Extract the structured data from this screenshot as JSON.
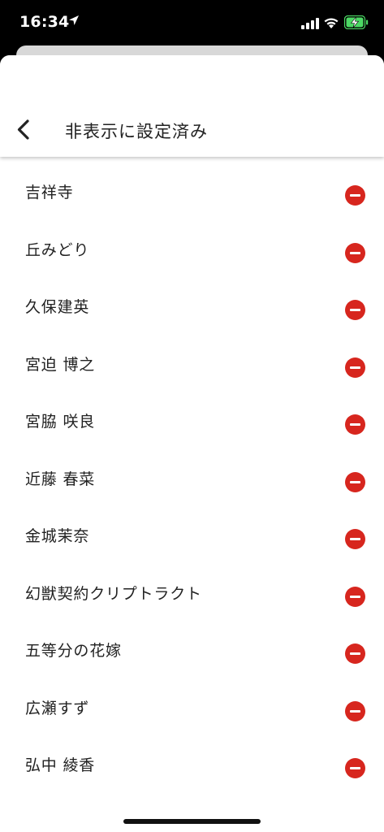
{
  "status_bar": {
    "time": "16:34",
    "location_icon": "location-arrow-icon",
    "signal_icon": "cellular-signal-icon",
    "wifi_icon": "wifi-icon",
    "battery_icon": "battery-charging-icon",
    "battery_color": "#4cd964"
  },
  "header": {
    "back_icon": "chevron-left-icon",
    "title": "非表示に設定済み"
  },
  "colors": {
    "remove_button": "#d7261e",
    "text": "#222222"
  },
  "hidden_list": {
    "remove_icon": "minus-circle-icon",
    "items": [
      {
        "label": "吉祥寺"
      },
      {
        "label": "丘みどり"
      },
      {
        "label": "久保建英"
      },
      {
        "label": "宮迫 博之"
      },
      {
        "label": "宮脇 咲良"
      },
      {
        "label": "近藤 春菜"
      },
      {
        "label": "金城茉奈"
      },
      {
        "label": "幻獣契約クリプトラクト"
      },
      {
        "label": "五等分の花嫁"
      },
      {
        "label": "広瀬すず"
      },
      {
        "label": "弘中 綾香"
      }
    ]
  }
}
